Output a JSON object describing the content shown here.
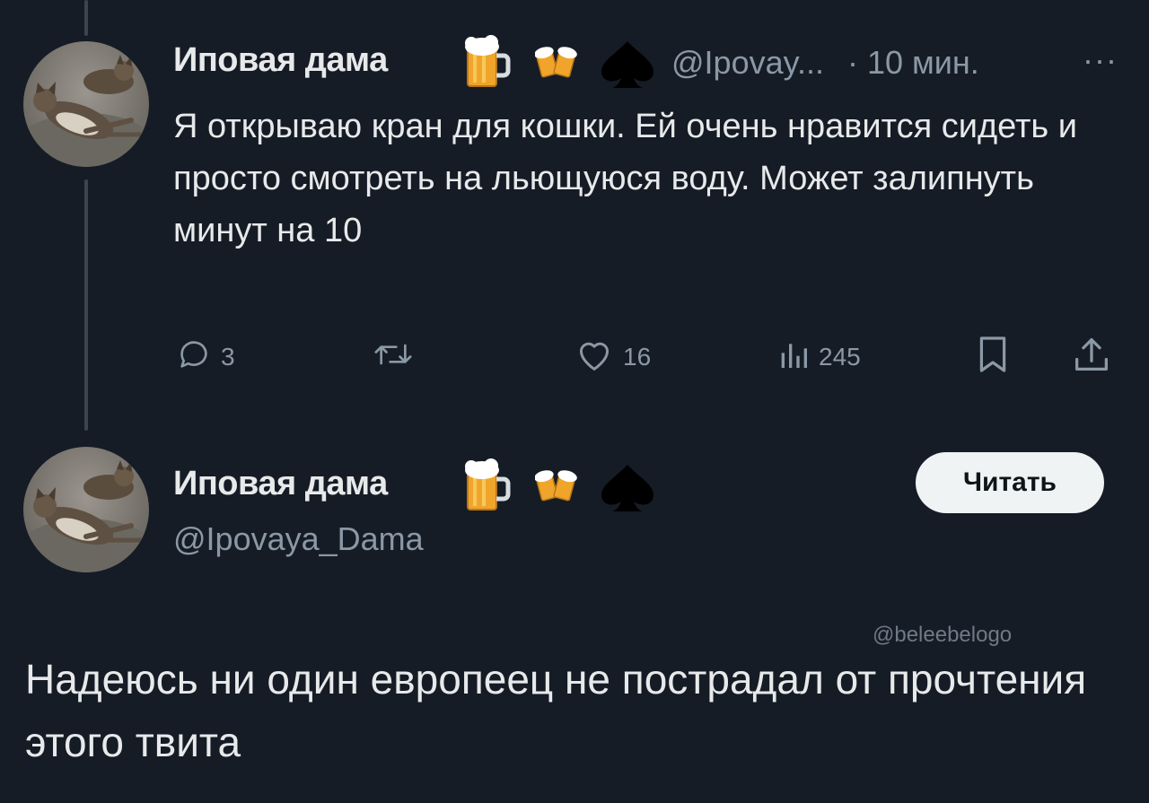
{
  "tweet": {
    "author_name": "Иповая дама",
    "emojis": [
      "beer-mug-emoji",
      "clinking-beer-mugs-emoji",
      "spade-suit-emoji"
    ],
    "handle": "@Ipovay...",
    "separator": "·",
    "time": "10 мин.",
    "more": "···",
    "text": "Я открываю кран для кошки. Ей очень нравится сидеть и просто смотреть на льющуюся воду. Может залипнуть минут на 10",
    "actions": {
      "replies": "3",
      "retweets": "",
      "likes": "16",
      "views": "245"
    }
  },
  "profile_card": {
    "author_name": "Иповая дама",
    "handle": "@Ipovaya_Dama",
    "follow_label": "Читать"
  },
  "watermark": "@beleebelogo",
  "caption": "Надеюсь ни один европеец не пострадал от прочтения этого твита",
  "colors": {
    "background": "#161c26",
    "text": "#e7e9ea",
    "muted": "#8b98a5",
    "button_bg": "#eff3f4"
  }
}
